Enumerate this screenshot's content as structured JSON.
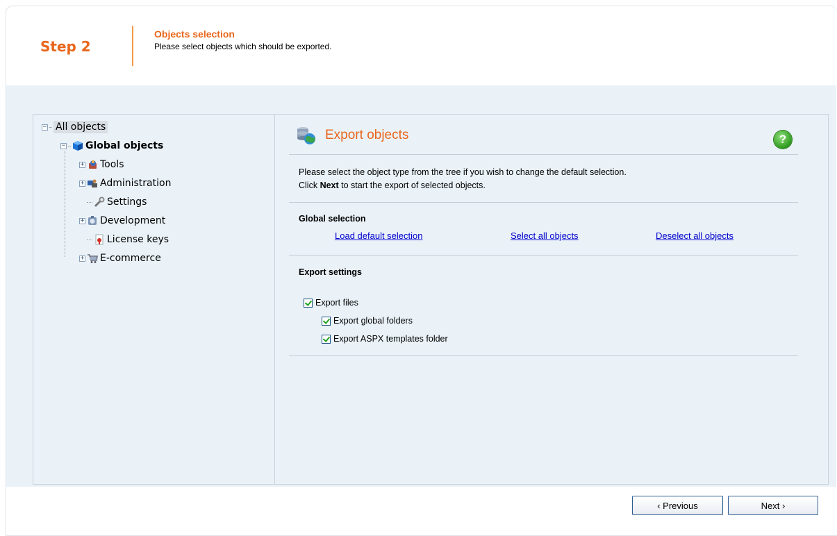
{
  "header": {
    "step": "Step 2",
    "title": "Objects selection",
    "description": "Please select objects which should be exported."
  },
  "tree": {
    "root": "All objects",
    "global": "Global objects",
    "items": [
      {
        "label": "Tools",
        "icon": "tools-icon",
        "expandable": true
      },
      {
        "label": "Administration",
        "icon": "administration-icon",
        "expandable": true
      },
      {
        "label": "Settings",
        "icon": "settings-icon",
        "expandable": false
      },
      {
        "label": "Development",
        "icon": "development-icon",
        "expandable": true
      },
      {
        "label": "License keys",
        "icon": "license-keys-icon",
        "expandable": false
      },
      {
        "label": "E-commerce",
        "icon": "ecommerce-icon",
        "expandable": true
      }
    ]
  },
  "main": {
    "title": "Export objects",
    "intro_line1": "Please select the object type from the tree if you wish to change the default selection.",
    "intro_prefix": "Click ",
    "intro_bold": "Next",
    "intro_suffix": " to start the export of selected objects.",
    "global_selection": {
      "title": "Global selection",
      "links": [
        "Load default selection",
        "Select all objects",
        "Deselect all objects"
      ]
    },
    "export_settings": {
      "title": "Export settings",
      "checkboxes": [
        {
          "label": "Export files",
          "checked": true
        },
        {
          "label": "Export global folders",
          "checked": true
        },
        {
          "label": "Export ASPX templates folder",
          "checked": true
        }
      ]
    }
  },
  "buttons": {
    "previous": "‹ Previous",
    "next": "Next ›"
  },
  "colors": {
    "accent": "#e9661c",
    "link": "#0000cc",
    "band": "#eaf2f8"
  }
}
